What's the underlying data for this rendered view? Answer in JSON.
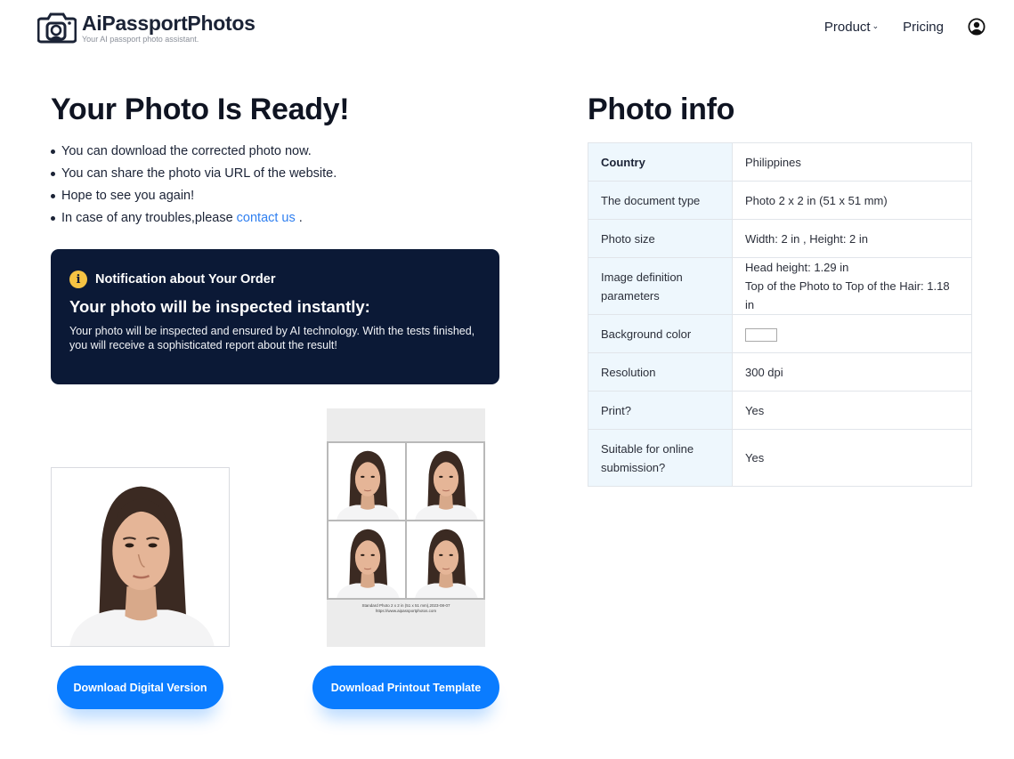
{
  "header": {
    "brand_name": "AiPassportPhotos",
    "brand_tagline": "Your AI passport photo assistant.",
    "nav": {
      "product_label": "Product",
      "pricing_label": "Pricing"
    }
  },
  "ready": {
    "title": "Your Photo Is Ready!",
    "bullets": [
      "You can download the corrected photo now.",
      "You can share the photo via URL of the website.",
      "Hope to see you again!"
    ],
    "last_bullet_prefix": "In case of any troubles,please",
    "contact_link": "contact us",
    "last_bullet_suffix": "."
  },
  "notice": {
    "heading": "Notification about Your Order",
    "title": "Your photo will be inspected instantly:",
    "body": "Your photo will be inspected and ensured by AI technology. With the tests finished, you will receive a sophisticated report about the result!"
  },
  "sheet": {
    "caption_line1": "Standard Photo 2 x 2 in (51 x 51 mm),2023-08-07",
    "caption_line2": "https://www.aipassportphotos.com"
  },
  "buttons": {
    "digital": "Download Digital Version",
    "print": "Download Printout Template"
  },
  "photo_info": {
    "title": "Photo info",
    "rows": [
      {
        "key": "Country",
        "value": "Philippines"
      },
      {
        "key": "The document type",
        "value": "Photo 2 x 2 in (51 x 51 mm)"
      },
      {
        "key": "Photo size",
        "value": "Width: 2 in , Height: 2 in"
      },
      {
        "key": "Image definition parameters",
        "value": "Head height: 1.29 in",
        "value2": "Top of the Photo to Top of the Hair: 1.18 in"
      },
      {
        "key": "Background color",
        "value_color": "#ffffff"
      },
      {
        "key": "Resolution",
        "value": "300 dpi"
      },
      {
        "key": "Print?",
        "value": "Yes"
      },
      {
        "key": "Suitable for online submission?",
        "value": "Yes"
      }
    ]
  },
  "colors": {
    "accent": "#0a7cff",
    "notice_bg": "#0b1936",
    "info_icon": "#f6c343",
    "table_key_bg": "#eef7fd",
    "link": "#2f7ff0"
  }
}
